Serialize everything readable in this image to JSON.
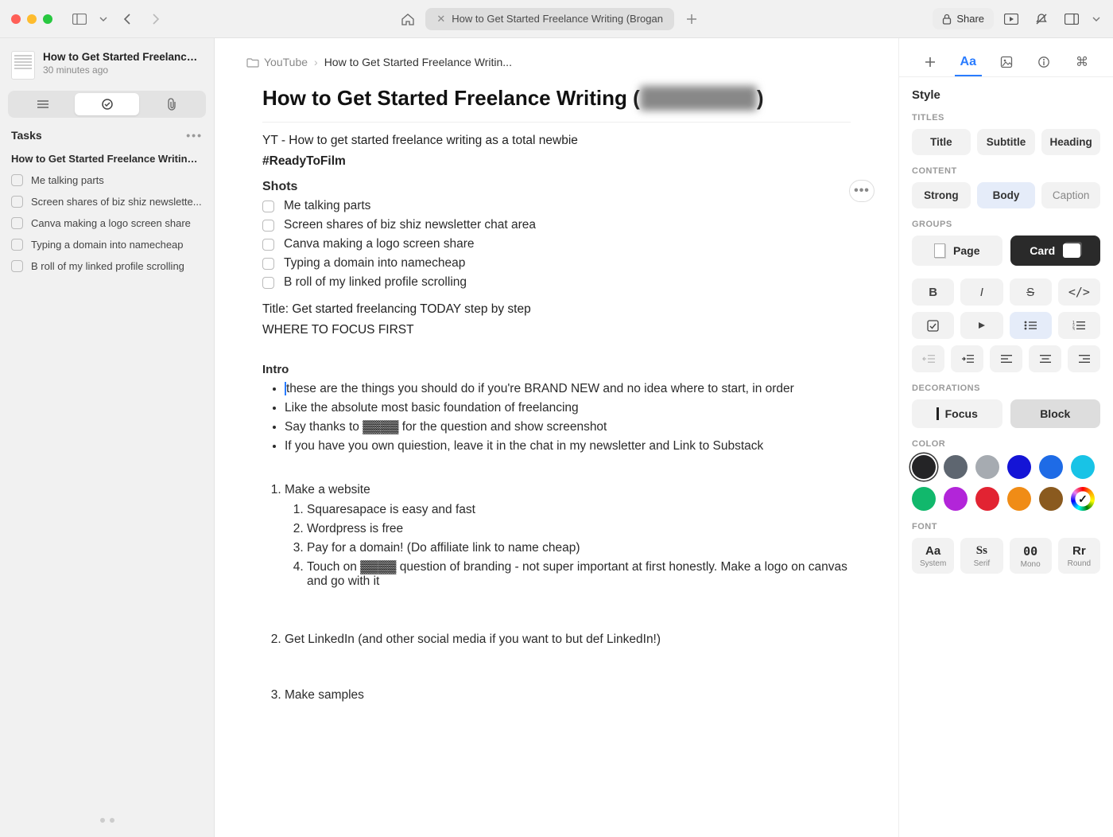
{
  "titlebar": {
    "tab_title": "How to Get Started Freelance Writing (Brogan",
    "share_label": "Share"
  },
  "sidebar": {
    "note_title": "How to Get Started Freelance Wr...",
    "note_time": "30 minutes ago",
    "tasks_label": "Tasks",
    "task_note_title": "How to Get Started Freelance Writing (B",
    "tasks": [
      "Me talking parts",
      "Screen shares of biz shiz newslette...",
      "Canva making a logo screen share",
      "Typing a domain into namecheap",
      "B roll of my linked profile scrolling"
    ]
  },
  "breadcrumbs": {
    "folder": "YouTube",
    "current": "How to Get Started Freelance Writin..."
  },
  "doc": {
    "title_prefix": "How to Get Started Freelance Writing (",
    "title_suffix": ")",
    "yt_line": "YT - How to get started freelance writing as a total newbie",
    "hashtag": "#ReadyToFilm",
    "shots_heading": "Shots",
    "shots": [
      "Me talking parts",
      "Screen shares of biz shiz newsletter chat area",
      "Canva making a logo screen share",
      "Typing a domain into namecheap",
      "B roll of my linked profile scrolling"
    ],
    "title_line": "Title: Get started freelancing TODAY step by step",
    "focus_line": "WHERE TO FOCUS FIRST",
    "intro_heading": "Intro",
    "intro_bullets": [
      "these are the things you should do if you're BRAND NEW and no idea where to start, in order",
      "Like the absolute most basic foundation of freelancing",
      "Say thanks to ▓▓▓▓ for the question and show screenshot",
      "If you have you own quiestion, leave it in the chat in my newsletter and Link to Substack"
    ],
    "list_1_title": "Make a website",
    "list_1_items": [
      "Squaresapace is easy and fast",
      "Wordpress is free",
      "Pay for a domain! (Do affiliate link to name cheap)",
      "Touch on ▓▓▓▓ question of branding - not super important at first honestly. Make a logo on canvas and go with it"
    ],
    "list_2_title": "Get LinkedIn (and other social media if you want to but def LinkedIn!)",
    "list_3_title": "Make samples"
  },
  "inspector": {
    "style_label": "Style",
    "titles_label": "TITLES",
    "titles": {
      "title": "Title",
      "subtitle": "Subtitle",
      "heading": "Heading"
    },
    "content_label": "CONTENT",
    "content": {
      "strong": "Strong",
      "body": "Body",
      "caption": "Caption"
    },
    "groups_label": "GROUPS",
    "groups": {
      "page": "Page",
      "card": "Card"
    },
    "decorations_label": "DECORATIONS",
    "decorations": {
      "focus": "Focus",
      "block": "Block"
    },
    "color_label": "COLOR",
    "colors": [
      "#242426",
      "#5e6670",
      "#a6abb1",
      "#1414d6",
      "#1e6be6",
      "#18c3e6",
      "#11b86c",
      "#b225d9",
      "#e22332",
      "#f08c16",
      "#8a5a1f"
    ],
    "font_label": "FONT",
    "fonts": [
      {
        "glyph": "Aa",
        "label": "System"
      },
      {
        "glyph": "Ss",
        "label": "Serif"
      },
      {
        "glyph": "00",
        "label": "Mono"
      },
      {
        "glyph": "Rr",
        "label": "Round"
      }
    ]
  }
}
